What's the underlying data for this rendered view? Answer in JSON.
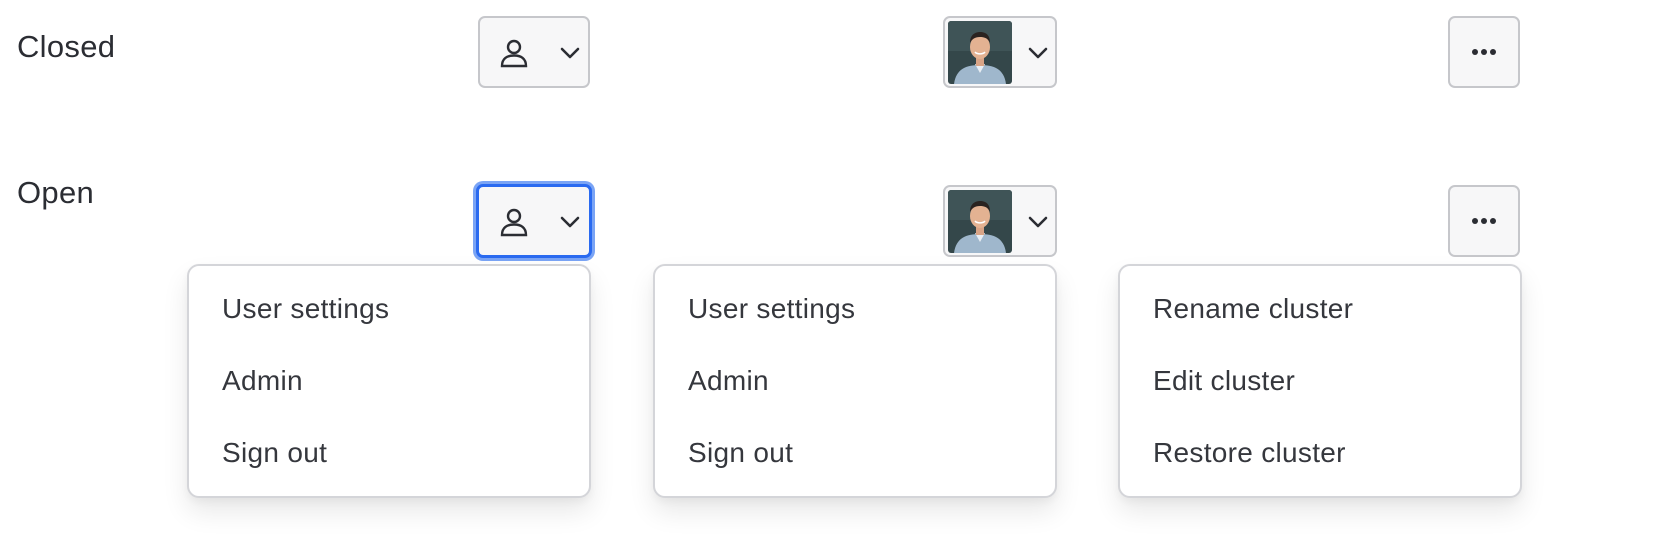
{
  "rows": {
    "closed_label": "Closed",
    "open_label": "Open"
  },
  "menus": {
    "user": [
      "User settings",
      "Admin",
      "Sign out"
    ],
    "avatar": [
      "User settings",
      "Admin",
      "Sign out"
    ],
    "cluster": [
      "Rename cluster",
      "Edit cluster",
      "Restore cluster"
    ]
  },
  "icons": {
    "user_trigger": "person-icon",
    "chevron": "chevron-down-icon",
    "more": "more-horizontal-icon"
  },
  "colors": {
    "focus_ring": "#2a6af0",
    "text": "#35373d",
    "border": "#c6c7cb"
  }
}
